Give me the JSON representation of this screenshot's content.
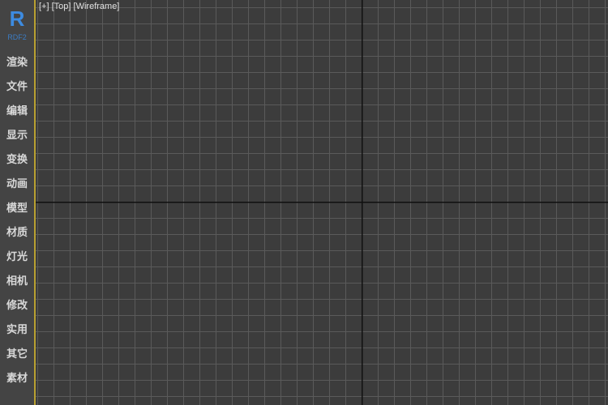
{
  "logo": {
    "letter": "R",
    "subtitle": "RDF2"
  },
  "sidebar": {
    "items": [
      {
        "label": "渲染"
      },
      {
        "label": "文件"
      },
      {
        "label": "编辑"
      },
      {
        "label": "显示"
      },
      {
        "label": "变换"
      },
      {
        "label": "动画"
      },
      {
        "label": "模型"
      },
      {
        "label": "材质"
      },
      {
        "label": "灯光"
      },
      {
        "label": "相机"
      },
      {
        "label": "修改"
      },
      {
        "label": "实用"
      },
      {
        "label": "其它"
      },
      {
        "label": "素材"
      }
    ]
  },
  "viewport": {
    "menu_plus": "[+]",
    "view_name": "[Top]",
    "shading": "[Wireframe]"
  },
  "colors": {
    "accent": "#3d8be0",
    "viewport_border": "#b8a030",
    "grid_line": "#5a5a5a",
    "axis_line": "#101010"
  }
}
